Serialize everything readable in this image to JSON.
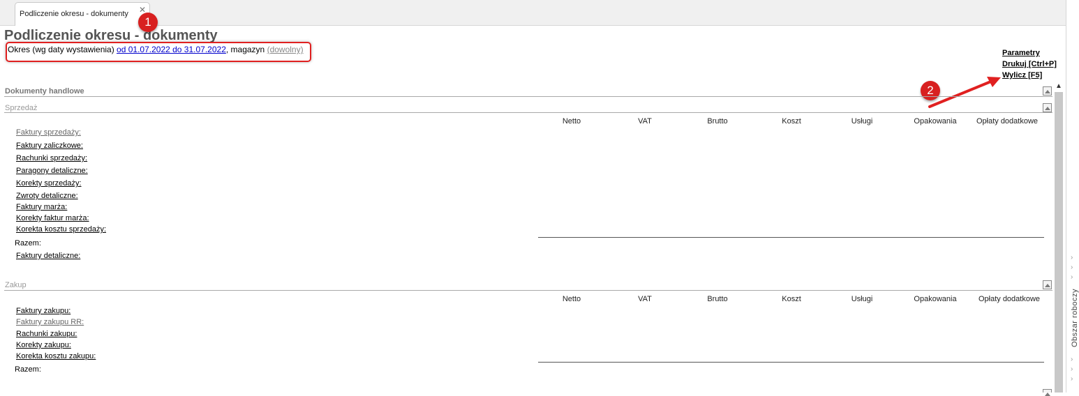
{
  "tab": {
    "label": "Podliczenie okresu - dokumenty",
    "close": "✕"
  },
  "page": {
    "title": "Podliczenie okresu - dokumenty",
    "period_prefix": "Okres (wg daty wystawienia) ",
    "period_link": "od 01.07.2022 do 31.07.2022",
    "period_mid": ", magazyn ",
    "warehouse_link": "(dowolny)"
  },
  "actions": {
    "parameters": "Parametry",
    "print": "Drukuj [Ctrl+P]",
    "calculate": "Wylicz [F5]"
  },
  "annotations": {
    "badge1": "1",
    "badge2": "2"
  },
  "sections": {
    "trade": {
      "label": "Dokumenty handlowe"
    },
    "sales": {
      "label": "Sprzedaż",
      "columns": [
        "Netto",
        "VAT",
        "Brutto",
        "Koszt",
        "Usługi",
        "Opakowania",
        "Opłaty dodatkowe"
      ],
      "rows": [
        "Faktury sprzedaży:",
        "Faktury zaliczkowe:",
        "Rachunki sprzedaży:",
        "Paragony detaliczne:",
        "Korekty sprzedaży:",
        "Zwroty detaliczne:",
        "Faktury marża:",
        "Korekty faktur marża:",
        "Korekta kosztu sprzedaży:"
      ],
      "total": "Razem:",
      "extra": "Faktury detaliczne:"
    },
    "purchase": {
      "label": "Zakup",
      "columns": [
        "Netto",
        "VAT",
        "Brutto",
        "Koszt",
        "Usługi",
        "Opakowania",
        "Opłaty dodatkowe"
      ],
      "rows": [
        "Faktury zakupu:",
        "Faktury zakupu RR:",
        "Rachunki zakupu:",
        "Korekty zakupu:",
        "Korekta kosztu zakupu:"
      ],
      "total": "Razem:"
    }
  },
  "sidebar": {
    "label": "Obszar roboczy",
    "chevron": "›"
  },
  "scroll": {
    "up": "▲"
  },
  "colors": {
    "annotation_red": "#d82020",
    "link_blue": "#0000cc"
  }
}
